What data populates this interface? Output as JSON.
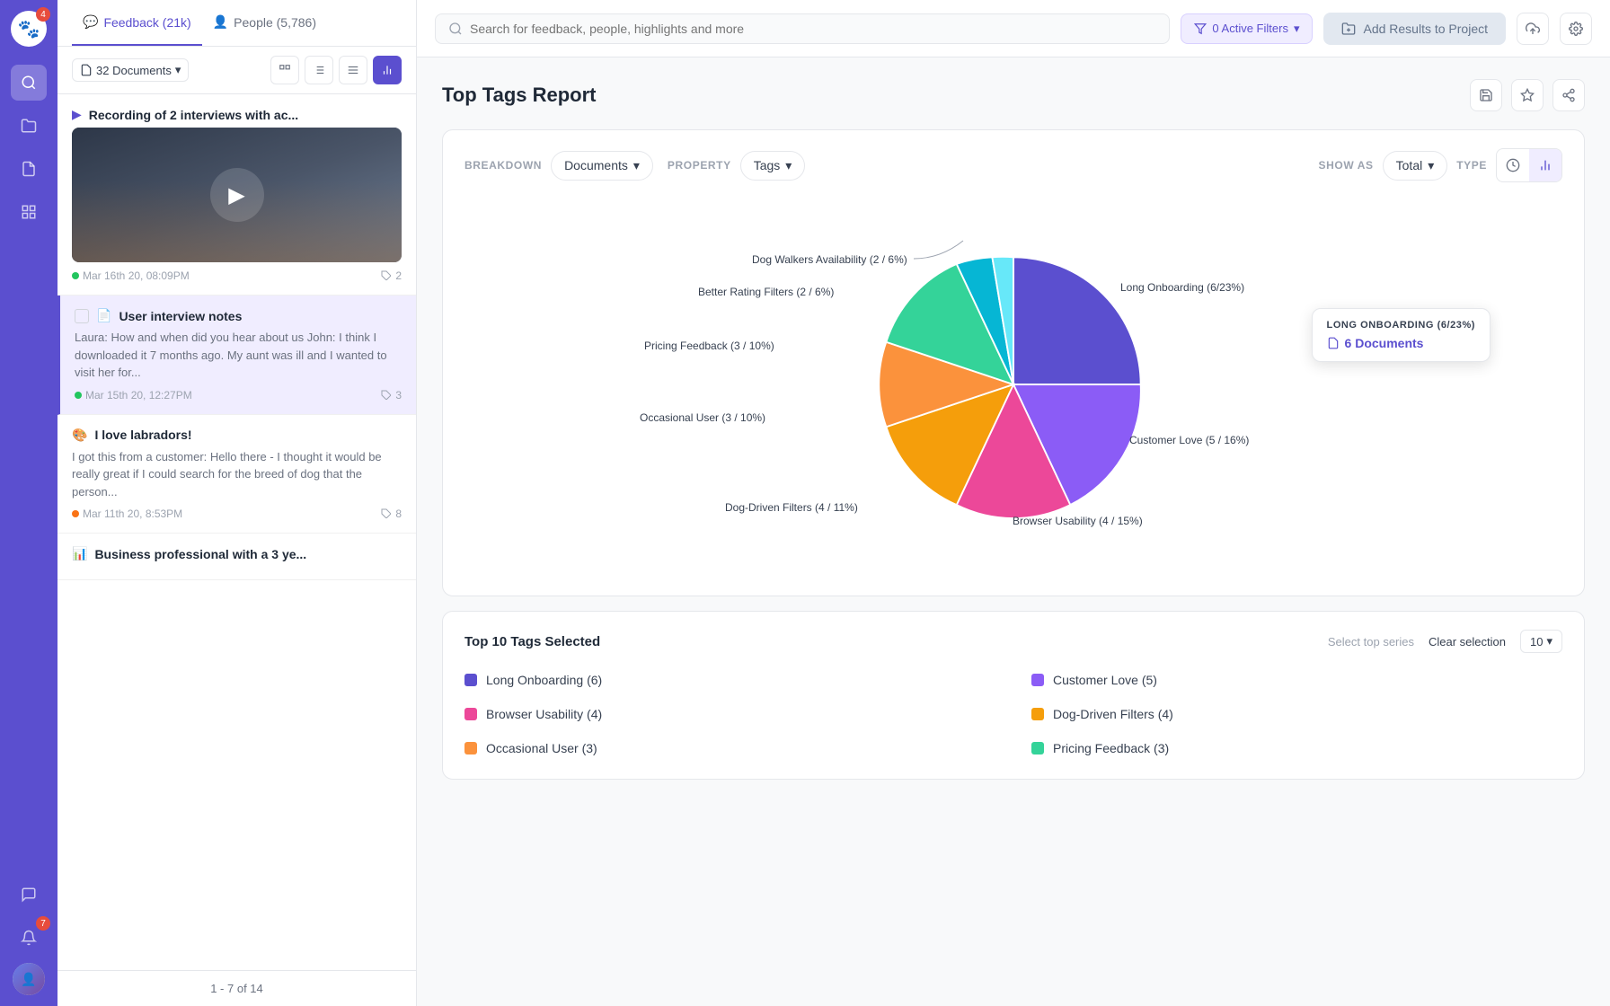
{
  "sidebar": {
    "logo_badge": "4",
    "icons": [
      "search",
      "folder",
      "document",
      "chart",
      "chat",
      "bell",
      "avatar"
    ],
    "notification_badge": "7"
  },
  "left_panel": {
    "tabs": [
      {
        "label": "Feedback (21k)",
        "icon": "💬",
        "active": true
      },
      {
        "label": "People (5,786)",
        "icon": "👤",
        "active": false
      }
    ],
    "doc_count": "32 Documents",
    "toolbar_icons": [
      "card-icon",
      "list-icon",
      "menu-icon",
      "chart-icon"
    ],
    "items": [
      {
        "id": 1,
        "icon": "▶",
        "title": "Recording of 2 interviews with ac...",
        "has_thumb": true,
        "status": "green",
        "date": "Mar 16th 20, 08:09PM",
        "tag_count": "2",
        "selected": false
      },
      {
        "id": 2,
        "icon": "📄",
        "title": "User interview notes",
        "has_thumb": false,
        "text": "Laura: How and when did you hear about us John:  I think I downloaded it 7 months ago. My aunt was ill and I wanted to visit her for...",
        "status": "green",
        "date": "Mar 15th 20, 12:27PM",
        "tag_count": "3",
        "selected": true
      },
      {
        "id": 3,
        "icon": "🎨",
        "title": "I love labradors!",
        "has_thumb": false,
        "text": "I got this from a customer: Hello there - I thought it would be really great if I could search for the breed of dog that the person...",
        "status": "orange",
        "date": "Mar 11th 20, 8:53PM",
        "tag_count": "8",
        "selected": false
      },
      {
        "id": 4,
        "icon": "📊",
        "title": "Business professional with a 3 ye...",
        "has_thumb": false,
        "selected": false
      }
    ],
    "pagination": "1 - 7 of 14"
  },
  "search": {
    "placeholder": "Search for feedback, people, highlights and more"
  },
  "active_filters": {
    "label": "0 Active Filters"
  },
  "add_results_btn": "Add Results to Project",
  "page_title": "Top Tags Report",
  "report": {
    "breakdown_label": "BREAKDOWN",
    "breakdown_value": "Documents",
    "property_label": "PROPERTY",
    "property_value": "Tags",
    "show_as_label": "SHOW AS",
    "show_as_value": "Total",
    "type_label": "TYPE"
  },
  "chart": {
    "tooltip": {
      "title": "LONG ONBOARDING (6/23%)",
      "count_label": "6 Documents"
    },
    "segments": [
      {
        "label": "Long Onboarding (6/23%)",
        "value": 23,
        "color": "#5b4fcf",
        "position": "right-top"
      },
      {
        "label": "Customer Love (5 / 16%)",
        "value": 16,
        "color": "#8b5cf6",
        "position": "right-bottom"
      },
      {
        "label": "Browser Usability (4 / 15%)",
        "value": 15,
        "color": "#ec4899",
        "position": "bottom-right"
      },
      {
        "label": "Dog-Driven Filters (4 / 11%)",
        "value": 11,
        "color": "#f59e0b",
        "position": "bottom-left"
      },
      {
        "label": "Occasional User (3 / 10%)",
        "value": 10,
        "color": "#fb923c",
        "position": "left-bottom"
      },
      {
        "label": "Pricing Feedback (3 / 10%)",
        "value": 10,
        "color": "#34d399",
        "position": "left-top"
      },
      {
        "label": "Better Rating Filters (2 / 6%)",
        "value": 6,
        "color": "#06b6d4",
        "position": "left-top2"
      },
      {
        "label": "Dog Walkers Availability (2 / 6%)",
        "value": 6,
        "color": "#67e8f9",
        "position": "top-left"
      }
    ]
  },
  "bottom_panel": {
    "title": "Top 10 Tags Selected",
    "select_top_label": "Select top series",
    "clear_label": "Clear selection",
    "top_n": "10",
    "tags": [
      {
        "label": "Long Onboarding (6)",
        "color": "#5b4fcf"
      },
      {
        "label": "Customer Love (5)",
        "color": "#8b5cf6"
      },
      {
        "label": "Browser Usability (4)",
        "color": "#ec4899"
      },
      {
        "label": "Dog-Driven Filters (4)",
        "color": "#f59e0b"
      },
      {
        "label": "Occasional User (3)",
        "color": "#fb923c"
      },
      {
        "label": "Pricing Feedback (3)",
        "color": "#34d399"
      }
    ]
  }
}
